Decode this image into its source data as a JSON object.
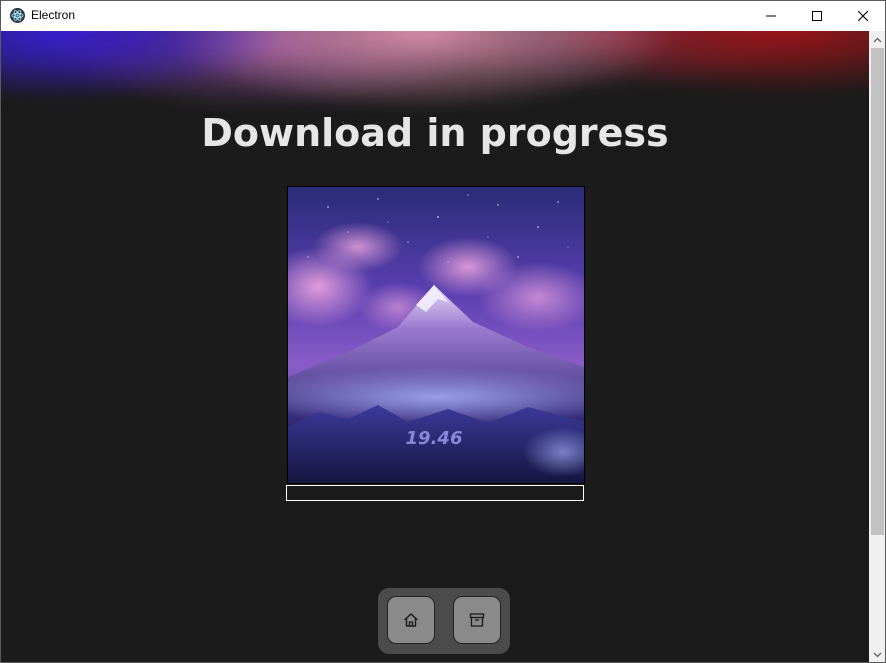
{
  "window": {
    "title": "Electron",
    "icon": "electron-icon",
    "controls": [
      "minimize-icon",
      "maximize-icon",
      "close-icon"
    ]
  },
  "page": {
    "heading": "Download in progress",
    "cover_art_text": "19.46",
    "progress_fraction": 0
  },
  "dock": {
    "buttons": [
      {
        "name": "home",
        "icon": "home-icon"
      },
      {
        "name": "archive",
        "icon": "archive-icon"
      }
    ]
  },
  "colors": {
    "background": "#1b1b1b",
    "heading": "#e6e6e6",
    "dock": "#4b4b4b",
    "dock_button": "#8a8a8a",
    "progress_border": "#ffffff"
  }
}
